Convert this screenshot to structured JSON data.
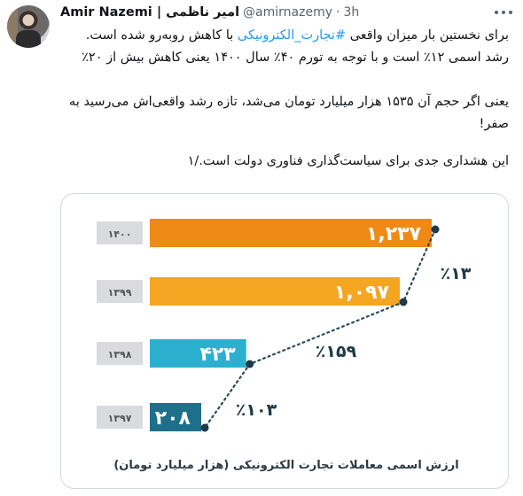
{
  "tweet": {
    "author_name": "Amir Nazemi | امیر ناظمی",
    "handle": "@amirnazemy",
    "separator": "·",
    "time": "3h",
    "text_before_hashtag": "برای نخستین بار میزان واقعی ",
    "hashtag": "#تجارت_الکترونیکی",
    "text_after_hashtag": " با کاهش روبه‌رو شده است. رشد اسمی ۱۲٪ است و با توجه به تورم ۴۰٪ سال ۱۴۰۰ یعنی کاهش بیش از ۲۰٪",
    "paragraph2": "یعنی اگر حجم آن ۱۵۳۵ هزار میلیارد تومان می‌شد، تازه رشد واقعی‌اش می‌رسید به صفر!",
    "paragraph3": "این هشداری جدی برای سیاست‌گذاری فناوری دولت است./۱",
    "icons": {
      "avatar": "profile-photo",
      "more": "more-horizontal-icon"
    }
  },
  "chart_data": {
    "type": "bar",
    "title": "ارزش اسمی معاملات تجارت الکترونیکی (هزار میلیارد تومان)",
    "categories": [
      "۱۴۰۰",
      "۱۳۹۹",
      "۱۳۹۸",
      "۱۳۹۷"
    ],
    "values": [
      1237,
      1097,
      423,
      208
    ],
    "value_labels": [
      "۱,۲۳۷",
      "۱,۰۹۷",
      "۴۲۳",
      "۲۰۸"
    ],
    "year_labels": [
      "۱۴۰۰",
      "۱۳۹۹",
      "۱۳۹۸",
      "۱۳۹۷"
    ],
    "growth_labels": [
      "٪۱۳",
      "٪۱۵۹",
      "٪۱۰۳"
    ],
    "colors": [
      "#ef8a17",
      "#f4a623",
      "#2bb0cf",
      "#1d6f8a"
    ],
    "max_value": 1237
  }
}
